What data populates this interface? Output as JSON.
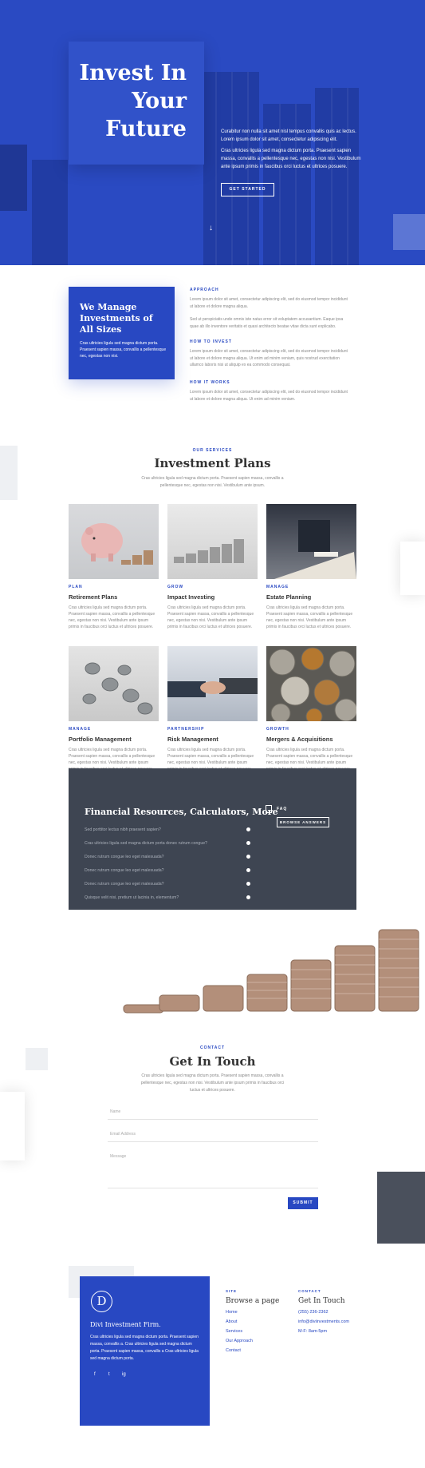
{
  "colors": {
    "primary": "#2848c2",
    "dark": "#3e4552",
    "text": "#666666"
  },
  "hero": {
    "title": "Invest In Your Future",
    "p1": "Curabitur non nulla sit amet nisl tempus convallis quis ac lectus. Lorem ipsum dolor sit amet, consectetur adipiscing elit.",
    "p2": "Cras ultricies ligula sed magna dictum porta. Praesent sapien massa, convallis a pellentesque nec, egestas non nisi. Vestibulum ante ipsum primis in faucibus orci luctus et ultrices posuere.",
    "button": "GET STARTED",
    "arrow": "↓"
  },
  "about": {
    "title": "We Manage Investments of All Sizes",
    "text": "Cras ultricies ligula sed magna dictum porta. Praesent sapien massa, convallis a pellentesque nec, egestas non nisi.",
    "sections": [
      {
        "head": "APPROACH",
        "p": "Lorem ipsum dolor sit amet, consectetur adipiscing elit, sed do eiusmod tempor incididunt ut labore et dolore magna aliqua.",
        "p2": "Sed ut perspiciatis unde omnis iste natus error sit voluptatem accusantium. Eaque ipsa quae ab illo inventore veritatis et quasi architecto beatae vitae dicta sunt explicabo."
      },
      {
        "head": "HOW TO INVEST",
        "p": "Lorem ipsum dolor sit amet, consectetur adipiscing elit, sed do eiusmod tempor incididunt ut labore et dolore magna aliqua. Ut enim ad minim veniam, quis nostrud exercitation ullamco laboris nisi ut aliquip ex ea commodo consequat."
      },
      {
        "head": "HOW IT WORKS",
        "p": "Lorem ipsum dolor sit amet, consectetur adipiscing elit, sed do eiusmod tempor incididunt ut labore et dolore magna aliqua. Ut enim ad minim veniam."
      }
    ]
  },
  "services": {
    "label": "OUR SERVICES",
    "title": "Investment Plans",
    "sub": "Cras ultricies ligula sed magna dictum porta. Praesent sapien massa, convallis a pellentesque nec, egestas non nisi. Vestibulum ante ipsum.",
    "cards": [
      {
        "cat": "PLAN",
        "title": "Retirement Plans",
        "text": "Cras ultricies ligula sed magna dictum porta. Praesent sapien massa, convallis a pellentesque nec, egestas non nisi. Vestibulum ante ipsum primis in faucibus orci luctus et ultrices posuere."
      },
      {
        "cat": "GROW",
        "title": "Impact Investing",
        "text": "Cras ultricies ligula sed magna dictum porta. Praesent sapien massa, convallis a pellentesque nec, egestas non nisi. Vestibulum ante ipsum primis in faucibus orci luctus et ultrices posuere."
      },
      {
        "cat": "MANAGE",
        "title": "Estate Planning",
        "text": "Cras ultricies ligula sed magna dictum porta. Praesent sapien massa, convallis a pellentesque nec, egestas non nisi. Vestibulum ante ipsum primis in faucibus orci luctus et ultrices posuere."
      },
      {
        "cat": "MANAGE",
        "title": "Portfolio Management",
        "text": "Cras ultricies ligula sed magna dictum porta. Praesent sapien massa, convallis a pellentesque nec, egestas non nisi. Vestibulum ante ipsum primis in faucibus orci luctus et ultrices posuere."
      },
      {
        "cat": "PARTNERSHIP",
        "title": "Risk Management",
        "text": "Cras ultricies ligula sed magna dictum porta. Praesent sapien massa, convallis a pellentesque nec, egestas non nisi. Vestibulum ante ipsum primis in faucibus orci luctus et ultrices posuere."
      },
      {
        "cat": "GROWTH",
        "title": "Mergers & Acquisitions",
        "text": "Cras ultricies ligula sed magna dictum porta. Praesent sapien massa, convallis a pellentesque nec, egestas non nisi. Vestibulum ante ipsum primis in faucibus orci luctus et ultrices posuere."
      }
    ]
  },
  "faq": {
    "title": "Financial Resources, Calculators, More",
    "items": [
      "Sed porttitor lectus nibh praesent sapien?",
      "Cras ultricies ligula sed magna dictum porta donec rutrum congue?",
      "Donec rutrum congue leo eget malesuada?",
      "Donec rutrum congue leo eget malesuada?",
      "Donec rutrum congue leo eget malesuada?",
      "Quisque velit nisi, pretium ut lacinia in, elementum?"
    ],
    "side_label": "FAQ",
    "button": "BROWSE ANSWERS"
  },
  "contact": {
    "label": "CONTACT",
    "title": "Get In Touch",
    "sub": "Cras ultricies ligula sed magna dictum porta. Praesent sapien massa, convallis a pellentesque nec, egestas non nisi. Vestibulum ante ipsum primis in faucibus orci luctus et ultrices posuere.",
    "name_placeholder": "Name",
    "email_placeholder": "Email Address",
    "message_placeholder": "Message",
    "submit": "SUBMIT"
  },
  "footer": {
    "logo_letter": "D",
    "firm": "Divi Investment Firm.",
    "desc": "Cras ultricies ligula sed magna dictum porta. Praesent sapien massa, convallis a. Cras ultricies ligula sed magna dictum porta. Praesent sapien massa, convallis a Cras ultricies ligula sed magna dictum porta.",
    "social": [
      "f",
      "t",
      "ig"
    ],
    "site_head": "SITE",
    "site_title": "Browse a page",
    "links": [
      "Home",
      "About",
      "Services",
      "Our Approach",
      "Contact"
    ],
    "contact_head": "CONTACT",
    "contact_title": "Get In Touch",
    "phone": "(255) 236-2362",
    "email": "info@diviinvestments.com",
    "hours": "M-F: 8am-5pm"
  }
}
